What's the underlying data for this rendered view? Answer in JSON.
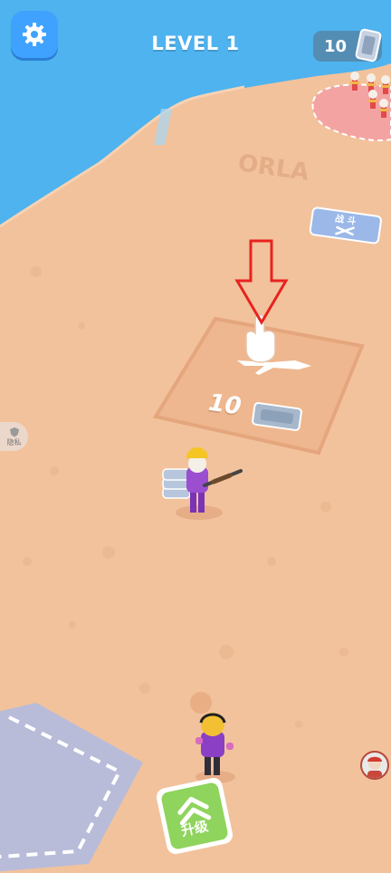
{
  "hud": {
    "level_label": "LEVEL 1",
    "currency_value": "10",
    "settings_icon": "gear-icon",
    "currency_icon": "cash-stack-icon"
  },
  "map": {
    "ground_text": "ORLA",
    "sign_text": "战 斗",
    "weapon_zone_cost": "10",
    "weapon_zone_icon": "rifle-icon",
    "tutorial_icon": "pointing-hand-icon",
    "arrow_icon": "down-arrow-icon"
  },
  "privacy": {
    "label": "隐私",
    "icon": "shield-icon"
  },
  "upgrade": {
    "label": "升级",
    "icon": "double-chevron-up-icon"
  },
  "colors": {
    "sand": "#f2c29c",
    "water": "#4eb3ef",
    "hud_blue": "#3fa2ff",
    "upgrade_green": "#8fd45c",
    "enemy_zone": "#f4a3a3"
  }
}
